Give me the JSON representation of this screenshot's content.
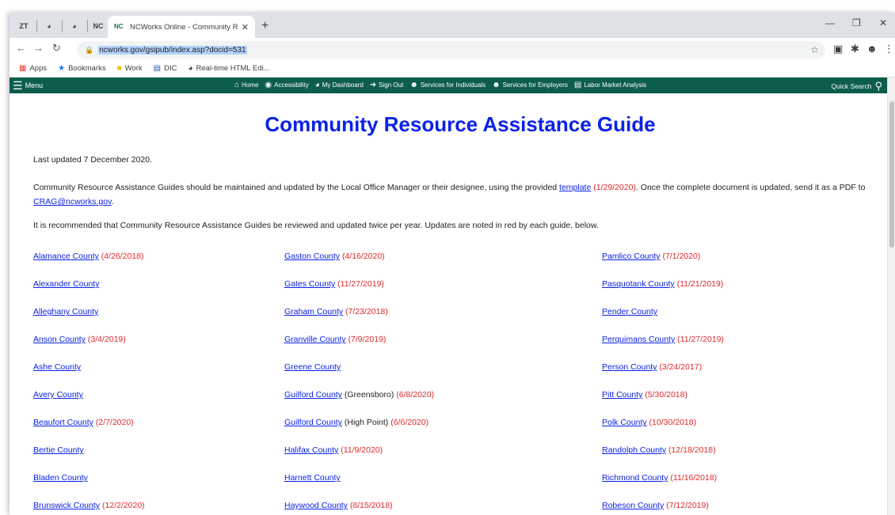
{
  "browser": {
    "pinned_tabs": [
      "ZT",
      "",
      "",
      "NC"
    ],
    "active_tab_title": "NCWorks Online - Community R",
    "url": "ncworks.gov/gsipub/index.asp?docid=531",
    "bookmarks": [
      "Apps",
      "Bookmarks",
      "Work",
      "DIC",
      "Real-time HTML Edi..."
    ]
  },
  "sitenav": {
    "menu": "Menu",
    "links": [
      "Home",
      "Accessibility",
      "My Dashboard",
      "Sign Out",
      "Services for Individuals",
      "Services for Employers",
      "Labor Market Analysis"
    ],
    "quick_search": "Quick Search"
  },
  "page": {
    "title": "Community Resource Assistance Guide",
    "updated": "Last updated 7 December 2020.",
    "para2_a": "Community Resource Assistance Guides should be maintained and updated by the Local Office Manager or their designee, using the provided ",
    "template_link": "template",
    "template_date": " (1/29/2020)",
    "para2_b": ".  Once the complete document is updated, send it as a PDF to ",
    "email": "CRAG@ncworks.gov",
    "para2_c": ".",
    "para3": "It is recommended that Community Resource Assistance Guides be reviewed and updated twice per year. Updates are noted in red by each guide, below."
  },
  "counties": {
    "col1": [
      {
        "name": "Alamance County",
        "note": "",
        "date": " (4/26/2018)"
      },
      {
        "name": "Alexander County",
        "note": "",
        "date": ""
      },
      {
        "name": "Alleghany County",
        "note": "",
        "date": ""
      },
      {
        "name": "Anson County",
        "note": "",
        "date": " (3/4/2019)"
      },
      {
        "name": "Ashe County",
        "note": "",
        "date": ""
      },
      {
        "name": "Avery County",
        "note": "",
        "date": ""
      },
      {
        "name": "Beaufort County",
        "note": "",
        "date": " (2/7/2020)"
      },
      {
        "name": "Bertie County",
        "note": "",
        "date": ""
      },
      {
        "name": "Bladen County",
        "note": "",
        "date": ""
      },
      {
        "name": "Brunswick County",
        "note": "",
        "date": " (12/2/2020)"
      }
    ],
    "col2": [
      {
        "name": "Gaston County",
        "note": "",
        "date": " (4/16/2020)"
      },
      {
        "name": "Gates County",
        "note": "",
        "date": " (11/27/2019)"
      },
      {
        "name": "Graham County",
        "note": "",
        "date": " (7/23/2018)"
      },
      {
        "name": "Granville County",
        "note": "",
        "date": " (7/9/2019)"
      },
      {
        "name": "Greene County",
        "note": "",
        "date": ""
      },
      {
        "name": "Guilford County",
        "note": " (Greensboro)",
        "date": " (6/8/2020)"
      },
      {
        "name": "Guilford County",
        "note": " (High Point)",
        "date": " (6/6/2020)"
      },
      {
        "name": "Halifax County",
        "note": "",
        "date": " (11/9/2020)"
      },
      {
        "name": "Harnett County",
        "note": "",
        "date": ""
      },
      {
        "name": "Haywood County",
        "note": "",
        "date": " (8/15/2018)"
      }
    ],
    "col3": [
      {
        "name": "Pamlico County",
        "note": "",
        "date": " (7/1/2020)"
      },
      {
        "name": "Pasquotank County",
        "note": "",
        "date": " (11/21/2019)"
      },
      {
        "name": "Pender County",
        "note": "",
        "date": ""
      },
      {
        "name": "Perquimans County",
        "note": "",
        "date": " (11/27/2019)"
      },
      {
        "name": "Person County",
        "note": "",
        "date": " (3/24/2017)"
      },
      {
        "name": "Pitt County",
        "note": "",
        "date": " (5/30/2018)"
      },
      {
        "name": "Polk County",
        "note": "",
        "date": " (10/30/2018)"
      },
      {
        "name": "Randolph County",
        "note": "",
        "date": " (12/18/2018)"
      },
      {
        "name": "Richmond County",
        "note": "",
        "date": " (11/16/2018)"
      },
      {
        "name": "Robeson County",
        "note": "",
        "date": " (7/12/2019)"
      }
    ]
  }
}
